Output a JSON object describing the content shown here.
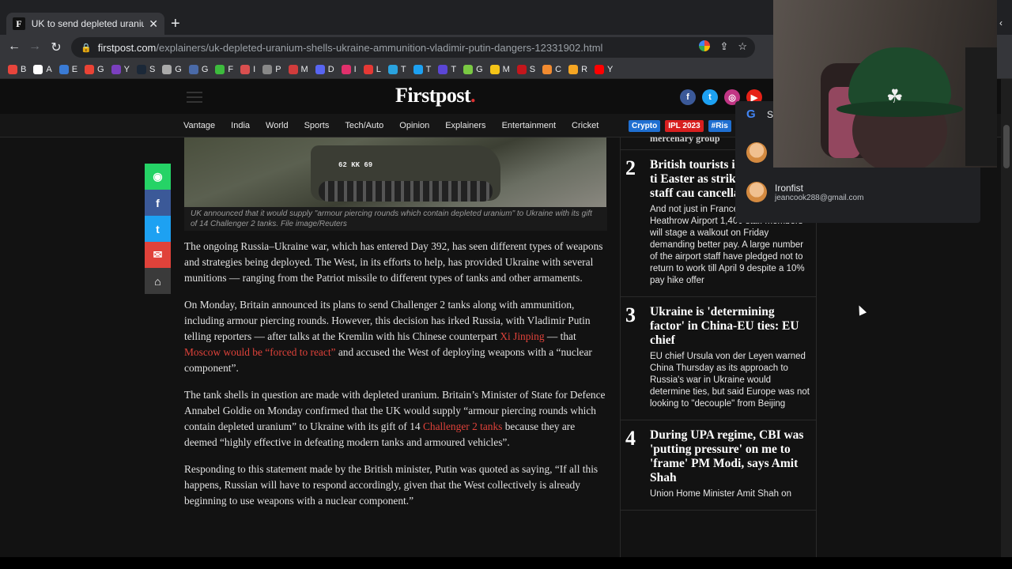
{
  "browser": {
    "tab_title": "UK to send depleted uranium sh...",
    "favicon_letter": "F",
    "new_tab": "+",
    "url_host": "firstpost.com",
    "url_path": "/explainers/uk-depleted-uranium-shells-ukraine-ammunition-vladimir-putin-dangers-12331902.html",
    "bookmarks": [
      {
        "label": "B",
        "color": "#e8453c"
      },
      {
        "label": "A",
        "color": "#ffffff"
      },
      {
        "label": "E",
        "color": "#3a7bd5"
      },
      {
        "label": "G",
        "color": "#ea4335"
      },
      {
        "label": "Y",
        "color": "#7b3fbf"
      },
      {
        "label": "S",
        "color": "#1b2838"
      },
      {
        "label": "G",
        "color": "#aaaaaa"
      },
      {
        "label": "G",
        "color": "#4a6aa8"
      },
      {
        "label": "F",
        "color": "#3dbb3d"
      },
      {
        "label": "I",
        "color": "#d94f4f"
      },
      {
        "label": "P",
        "color": "#888888"
      },
      {
        "label": "M",
        "color": "#d13c3c"
      },
      {
        "label": "D",
        "color": "#5865f2"
      },
      {
        "label": "I",
        "color": "#e1306c"
      },
      {
        "label": "L",
        "color": "#e53935"
      },
      {
        "label": "T",
        "color": "#2aa3df"
      },
      {
        "label": "T",
        "color": "#1da1f2"
      },
      {
        "label": "T",
        "color": "#5b46d6"
      },
      {
        "label": "G",
        "color": "#7ac943"
      },
      {
        "label": "M",
        "color": "#f5c518"
      },
      {
        "label": "S",
        "color": "#c4161c"
      },
      {
        "label": "C",
        "color": "#f28b30"
      },
      {
        "label": "R",
        "color": "#f6a623"
      },
      {
        "label": "Y",
        "color": "#ff0000"
      }
    ]
  },
  "site": {
    "logo": "Firstpost",
    "logo_dot": ".",
    "nav": [
      "Vantage",
      "India",
      "World",
      "Sports",
      "Tech/Auto",
      "Opinion",
      "Explainers",
      "Entertainment",
      "Cricket"
    ],
    "chips": [
      {
        "label": "Crypto",
        "color": "#1f6fd1"
      },
      {
        "label": "IPL 2023",
        "color": "#d81f1f"
      },
      {
        "label": "#Ris",
        "color": "#1f6fd1"
      }
    ]
  },
  "article": {
    "hero_plate": "62 KK 69",
    "caption": "UK announced that it would supply \"armour piercing rounds which contain depleted uranium\" to Ukraine with its gift of 14 Challenger 2 tanks. File image/Reuters",
    "p1": "The ongoing Russia–Ukraine war, which has entered Day 392, has seen different types of weapons and strategies being deployed. The West, in its efforts to help, has provided Ukraine with several munitions — ranging from the Patriot missile to different types of tanks and other armaments.",
    "p2_a": "On Monday, Britain announced its plans to send Challenger 2 tanks along with ammunition, including armour piercing rounds. However, this decision has irked Russia, with Vladimir Putin telling reporters — after talks at the Kremlin with his Chinese counterpart ",
    "p2_link1": "Xi Jinping",
    "p2_b": " — that ",
    "p2_link2": "Moscow would be “forced to react”",
    "p2_c": " and accused the West of deploying weapons with a “nuclear component”.",
    "p3_a": "The tank shells in question are made with depleted uranium. Britain’s Minister of State for Defence Annabel Goldie on Monday confirmed that the UK would supply “armour piercing rounds which contain depleted uranium” to Ukraine with its gift of 14 ",
    "p3_link": "Challenger 2 tanks",
    "p3_b": " because they are deemed “highly effective in defeating modern tanks and armoured vehicles”.",
    "p4": "Responding to this statement made by the British minister, Putin was quoted as saying, “If all this happens, Russian will have to respond accordingly, given that the West collectively is already beginning to use weapons with a nuclear component.”"
  },
  "sidebar": {
    "prev_tail": "mercenary group",
    "items": [
      {
        "num": "2",
        "title": "British tourists into turbulent ti Easter as strikes airport staff cau cancellations",
        "summary": "And not just in France, at Britain's busy Heathrow Airport 1,400 staff members will stage a walkout on Friday demanding better pay. A large number of the airport staff have pledged not to return to work till April 9 despite a 10% pay hike offer"
      },
      {
        "num": "3",
        "title": "Ukraine is 'determining factor' in China-EU ties: EU chief",
        "summary": "EU chief Ursula von der Leyen warned China Thursday as its approach to Russia's war in Ukraine would determine ties, but said Europe was not looking to \"decouple\" from Beijing"
      },
      {
        "num": "4",
        "title": "During UPA regime, CBI was 'putting pressure' on me to 'frame' PM Modi, says Amit Shah",
        "summary": "Union Home Minister Amit Shah on"
      }
    ]
  },
  "popup": {
    "google_letter": "G",
    "partial": "S",
    "account_name": "Ironfist",
    "account_email": "jeancook288@gmail.com"
  }
}
